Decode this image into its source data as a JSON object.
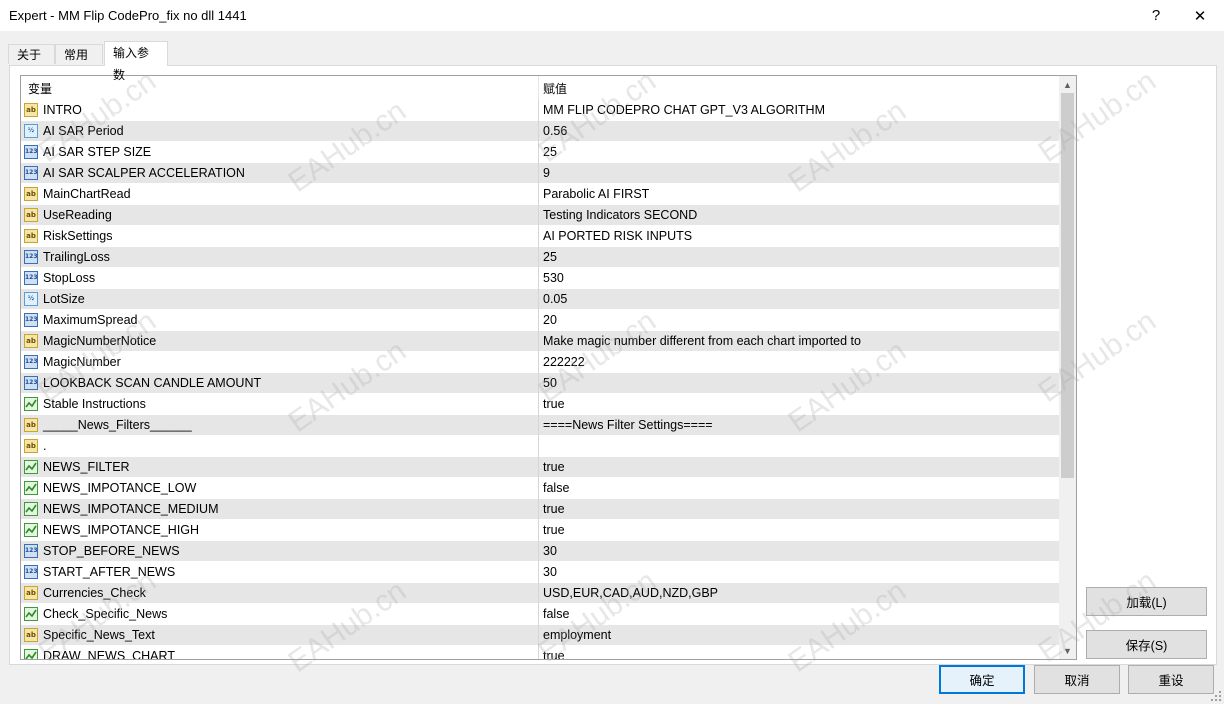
{
  "window": {
    "title": "Expert - MM Flip CodePro_fix no dll 1441",
    "help_label": "?",
    "close_label": "✕"
  },
  "tabs": [
    {
      "label": "关于"
    },
    {
      "label": "常用"
    },
    {
      "label": "输入参数"
    }
  ],
  "grid": {
    "col_variable": "变量",
    "col_value": "赋值",
    "rows": [
      {
        "type": "str",
        "icon": "string-icon",
        "name": "INTRO",
        "value": "MM FLIP CODEPRO CHAT GPT_V3 ALGORITHM"
      },
      {
        "type": "dbl",
        "icon": "double-icon",
        "name": "AI SAR Period",
        "value": "0.56"
      },
      {
        "type": "int",
        "icon": "integer-icon",
        "name": "AI SAR STEP SIZE",
        "value": "25"
      },
      {
        "type": "int",
        "icon": "integer-icon",
        "name": "AI SAR SCALPER ACCELERATION",
        "value": "9"
      },
      {
        "type": "str",
        "icon": "string-icon",
        "name": "MainChartRead",
        "value": "Parabolic AI FIRST"
      },
      {
        "type": "str",
        "icon": "string-icon",
        "name": "UseReading",
        "value": "Testing Indicators SECOND"
      },
      {
        "type": "str",
        "icon": "string-icon",
        "name": "RiskSettings",
        "value": "AI PORTED RISK INPUTS"
      },
      {
        "type": "int",
        "icon": "integer-icon",
        "name": "TrailingLoss",
        "value": "25"
      },
      {
        "type": "int",
        "icon": "integer-icon",
        "name": "StopLoss",
        "value": "530"
      },
      {
        "type": "dbl",
        "icon": "double-icon",
        "name": "LotSize",
        "value": "0.05"
      },
      {
        "type": "int",
        "icon": "integer-icon",
        "name": "MaximumSpread",
        "value": "20"
      },
      {
        "type": "str",
        "icon": "string-icon",
        "name": "MagicNumberNotice",
        "value": "Make magic number different from each chart imported to"
      },
      {
        "type": "int",
        "icon": "integer-icon",
        "name": "MagicNumber",
        "value": "222222"
      },
      {
        "type": "int",
        "icon": "integer-icon",
        "name": "LOOKBACK SCAN CANDLE AMOUNT",
        "value": "50"
      },
      {
        "type": "bool",
        "icon": "boolean-icon",
        "name": "Stable Instructions",
        "value": "true"
      },
      {
        "type": "str",
        "icon": "string-icon",
        "name": "_____News_Filters______",
        "value": "====News Filter Settings===="
      },
      {
        "type": "str",
        "icon": "string-icon",
        "name": ".",
        "value": ""
      },
      {
        "type": "bool",
        "icon": "boolean-icon",
        "name": "NEWS_FILTER",
        "value": "true"
      },
      {
        "type": "bool",
        "icon": "boolean-icon",
        "name": "NEWS_IMPOTANCE_LOW",
        "value": "false"
      },
      {
        "type": "bool",
        "icon": "boolean-icon",
        "name": "NEWS_IMPOTANCE_MEDIUM",
        "value": "true"
      },
      {
        "type": "bool",
        "icon": "boolean-icon",
        "name": "NEWS_IMPOTANCE_HIGH",
        "value": "true"
      },
      {
        "type": "int",
        "icon": "integer-icon",
        "name": "STOP_BEFORE_NEWS",
        "value": "30"
      },
      {
        "type": "int",
        "icon": "integer-icon",
        "name": "START_AFTER_NEWS",
        "value": "30"
      },
      {
        "type": "str",
        "icon": "string-icon",
        "name": "Currencies_Check",
        "value": "USD,EUR,CAD,AUD,NZD,GBP"
      },
      {
        "type": "bool",
        "icon": "boolean-icon",
        "name": "Check_Specific_News",
        "value": "false"
      },
      {
        "type": "str",
        "icon": "string-icon",
        "name": "Specific_News_Text",
        "value": "employment"
      },
      {
        "type": "bool",
        "icon": "boolean-icon",
        "name": "DRAW_NEWS_CHART",
        "value": "true"
      }
    ]
  },
  "icon_glyphs": {
    "str": "ab",
    "int": "123",
    "dbl": "½",
    "bool": ""
  },
  "buttons": {
    "load": "加载(L)",
    "save": "保存(S)",
    "ok": "确定",
    "cancel": "取消",
    "reset": "重设"
  },
  "watermark": "EAHub.cn",
  "colors": {
    "default_button_border": "#0078d7",
    "row_alt": "#e6e6e6"
  }
}
